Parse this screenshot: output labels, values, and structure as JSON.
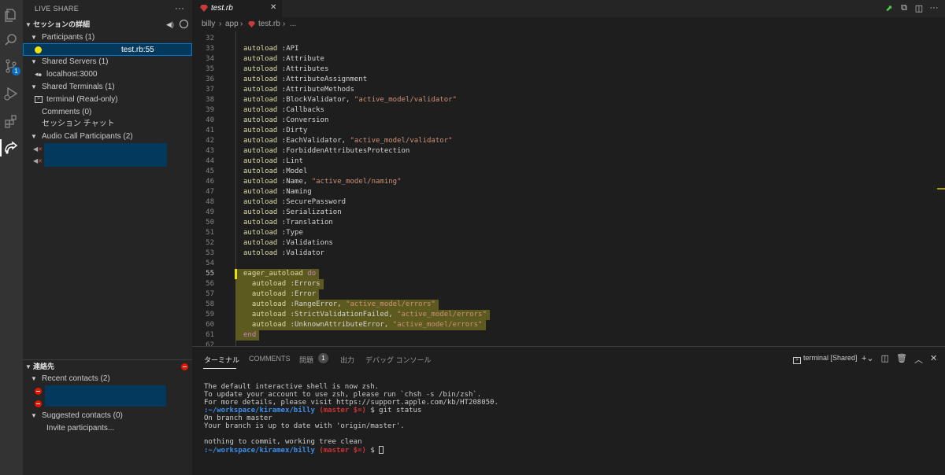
{
  "live_share": {
    "title": "LIVE SHARE",
    "more": "···",
    "session_details": "セッションの詳細",
    "participants": "Participants (1)",
    "participant_location": "test.rb:55",
    "shared_servers": "Shared Servers (1)",
    "server": "localhost:3000",
    "shared_terminals": "Shared Terminals (1)",
    "terminal": "terminal (Read-only)",
    "comments": "Comments (0)",
    "chat": "セッション チャット",
    "audio_call": "Audio Call Participants (2)",
    "contacts": "連絡先",
    "recent_contacts": "Recent contacts (2)",
    "suggested_contacts": "Suggested contacts (0)",
    "invite": "Invite participants..."
  },
  "activity_bar": {
    "icons": [
      "explorer-icon",
      "search-icon",
      "source-control-icon",
      "run-debug-icon",
      "extensions-icon",
      "live-share-icon"
    ],
    "scm_badge": "1"
  },
  "editor": {
    "tab": "test.rb",
    "tab_close": "✕",
    "breadcrumb": [
      "billy",
      "app",
      "test.rb",
      "..."
    ],
    "lines": [
      {
        "n": "32",
        "code": ""
      },
      {
        "n": "33",
        "code": "autoload :API"
      },
      {
        "n": "34",
        "code": "autoload :Attribute"
      },
      {
        "n": "35",
        "code": "autoload :Attributes"
      },
      {
        "n": "36",
        "code": "autoload :AttributeAssignment"
      },
      {
        "n": "37",
        "code": "autoload :AttributeMethods"
      },
      {
        "n": "38",
        "code": "autoload :BlockValidator, \"active_model/validator\""
      },
      {
        "n": "39",
        "code": "autoload :Callbacks"
      },
      {
        "n": "40",
        "code": "autoload :Conversion"
      },
      {
        "n": "41",
        "code": "autoload :Dirty"
      },
      {
        "n": "42",
        "code": "autoload :EachValidator, \"active_model/validator\""
      },
      {
        "n": "43",
        "code": "autoload :ForbiddenAttributesProtection"
      },
      {
        "n": "44",
        "code": "autoload :Lint"
      },
      {
        "n": "45",
        "code": "autoload :Model"
      },
      {
        "n": "46",
        "code": "autoload :Name, \"active_model/naming\""
      },
      {
        "n": "47",
        "code": "autoload :Naming"
      },
      {
        "n": "48",
        "code": "autoload :SecurePassword"
      },
      {
        "n": "49",
        "code": "autoload :Serialization"
      },
      {
        "n": "50",
        "code": "autoload :Translation"
      },
      {
        "n": "51",
        "code": "autoload :Type"
      },
      {
        "n": "52",
        "code": "autoload :Validations"
      },
      {
        "n": "53",
        "code": "autoload :Validator"
      },
      {
        "n": "54",
        "code": ""
      },
      {
        "n": "55",
        "code": "eager_autoload do"
      },
      {
        "n": "56",
        "code": "  autoload :Errors"
      },
      {
        "n": "57",
        "code": "  autoload :Error"
      },
      {
        "n": "58",
        "code": "  autoload :RangeError, \"active_model/errors\""
      },
      {
        "n": "59",
        "code": "  autoload :StrictValidationFailed, \"active_model/errors\""
      },
      {
        "n": "60",
        "code": "  autoload :UnknownAttributeError, \"active_model/errors\""
      },
      {
        "n": "61",
        "code": "end"
      },
      {
        "n": "62",
        "code": ""
      }
    ]
  },
  "panel": {
    "tabs": [
      "ターミナル",
      "COMMENTS",
      "問題",
      "出力",
      "デバッグ コンソール"
    ],
    "problems_count": "1",
    "terminal_select": "terminal [Shared]",
    "terminal_lines": [
      "The default interactive shell is now zsh.",
      "To update your account to use zsh, please run `chsh -s /bin/zsh`.",
      "For more details, please visit https://support.apple.com/kb/HT208050."
    ],
    "prompt_path": ":~/workspace/kiramex/billy",
    "prompt_branch": "(master $=)",
    "command": " $ git status",
    "output": [
      "On branch master",
      "Your branch is up to date with 'origin/master'.",
      "",
      "nothing to commit, working tree clean"
    ],
    "prompt_tail": " $ "
  }
}
